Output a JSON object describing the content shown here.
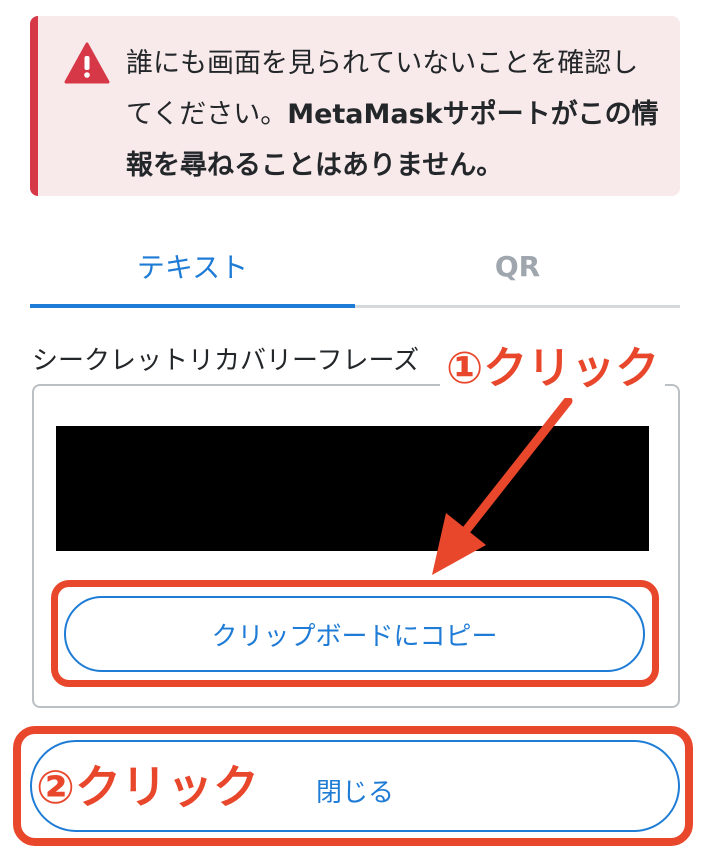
{
  "warning": {
    "icon": "warning-triangle-icon",
    "text_line1": "誰にも画面を見られていないことを確認し",
    "text_line2_normal": "てください。",
    "text_line2_bold": "MetaMaskサポートがこの情",
    "text_line3_bold": "報を尋ねることはありません。",
    "color": "#d73847"
  },
  "tabs": [
    {
      "label": "テキスト",
      "active": true
    },
    {
      "label": "QR",
      "active": false
    }
  ],
  "phrase": {
    "label": "シークレットリカバリーフレーズ"
  },
  "buttons": {
    "copy_label": "クリップボードにコピー",
    "close_label": "閉じる"
  },
  "annotations": {
    "step1": "①クリック",
    "step2": "②クリック",
    "color": "#e8472c"
  },
  "accent_color": "#1f7cd6"
}
